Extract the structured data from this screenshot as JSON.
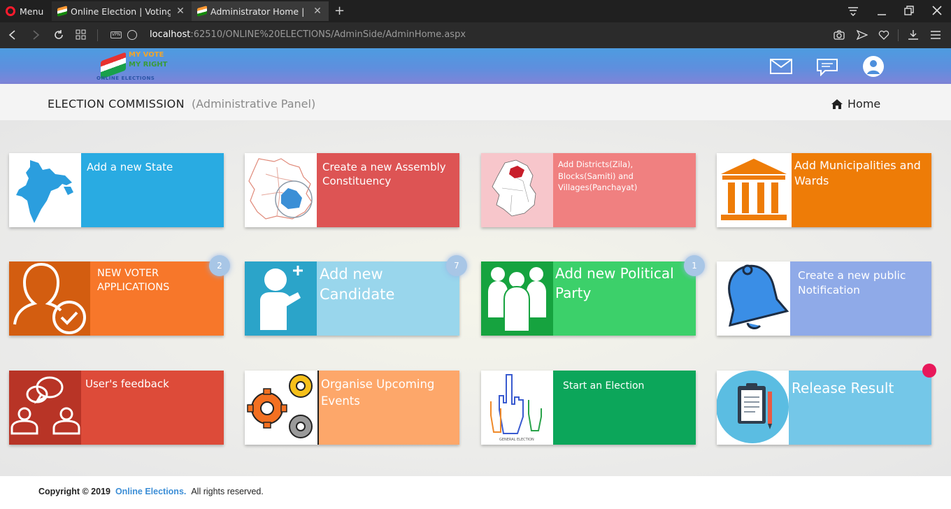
{
  "browser": {
    "menu_label": "Menu",
    "tabs": [
      {
        "title": "Online Election | Voting",
        "close": "✕"
      },
      {
        "title": "Administrator Home | Online Elections",
        "close": "✕"
      }
    ],
    "new_tab": "+",
    "url_host": "localhost",
    "url_rest": ":62510/ONLINE%20ELECTIONS/AdminSide/AdminHome.aspx",
    "vpn_label": "VPN"
  },
  "site": {
    "logo": {
      "line1": "MY VOTE",
      "line2": "MY RIGHT",
      "line3": "ONLINE ELECTIONS"
    },
    "header_icons": [
      "mail-icon",
      "chat-icon",
      "user-avatar-icon"
    ],
    "commission_title": "ELECTION COMMISSION",
    "panel_subtitle": "(Administrative Panel)",
    "home_label": "Home"
  },
  "tiles": [
    {
      "label": "Add a new State",
      "color": "#29abe2",
      "icon": "india-map-icon"
    },
    {
      "label": "Create a new Assembly Constituency",
      "color": "#dd5454",
      "icon": "constituency-map-icon"
    },
    {
      "label": "Add Districts(Zila), Blocks(Samiti) and Villages(Panchayat)",
      "color": "#f08080",
      "icon": "district-map-icon"
    },
    {
      "label": "Add Municipalities and Wards",
      "color": "#ee7c07",
      "icon": "building-icon"
    },
    {
      "label": "NEW VOTER APPLICATIONS",
      "color": "#f7772a",
      "icon": "voter-check-icon",
      "badge": "2"
    },
    {
      "label": "Add new Candidate",
      "color": "#99d6ec",
      "icon": "add-person-icon",
      "badge": "7"
    },
    {
      "label": "Add new Political Party",
      "color": "#3cd06a",
      "icon": "party-group-icon",
      "badge": "1"
    },
    {
      "label": "Create a new public Notification",
      "color": "#8faae8",
      "icon": "bell-icon"
    },
    {
      "label": "User's feedback",
      "color": "#dd4b39",
      "icon": "feedback-icon"
    },
    {
      "label": "Organise Upcoming Events",
      "color": "#fda76a",
      "icon": "gears-icon"
    },
    {
      "label": "Start an Election",
      "color": "#0ca65a",
      "icon": "voting-fingers-icon"
    },
    {
      "label": "Release Result",
      "color": "#74c7e8",
      "icon": "clipboard-icon"
    }
  ],
  "footer": {
    "copyright": "Copyright © 2019",
    "site_name": "Online Elections.",
    "rights": "All rights reserved."
  }
}
